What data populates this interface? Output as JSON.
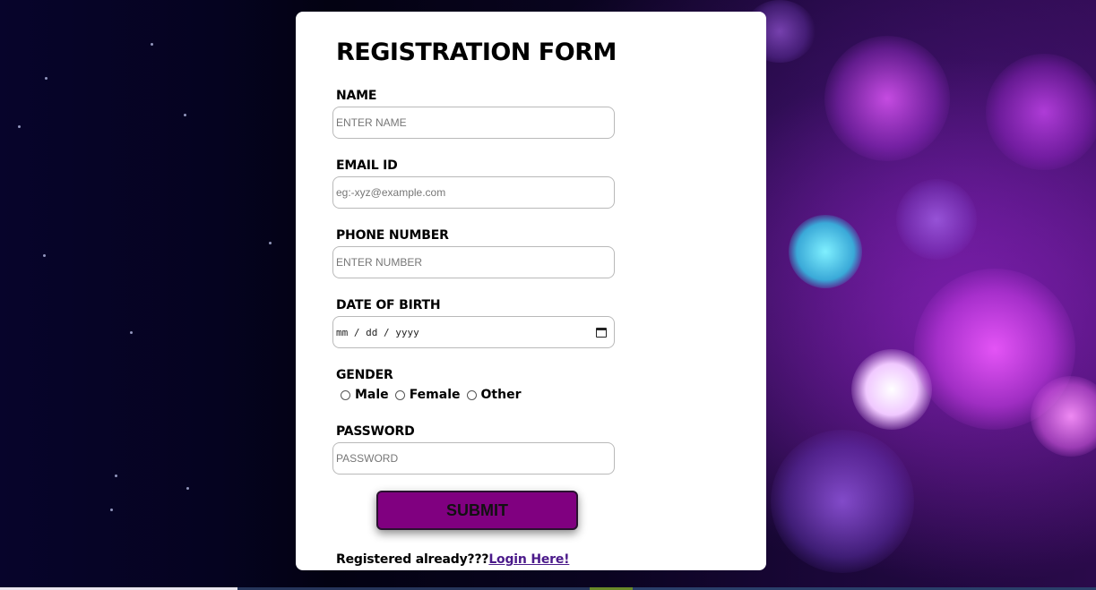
{
  "form": {
    "title": "REGISTRATION FORM",
    "name": {
      "label": "NAME",
      "placeholder": "ENTER NAME"
    },
    "email": {
      "label": "EMAIL ID",
      "placeholder": "eg:-xyz@example.com"
    },
    "phone": {
      "label": "PHONE NUMBER",
      "placeholder": "ENTER NUMBER"
    },
    "dob": {
      "label": "DATE OF BIRTH",
      "placeholder": "mm / dd / yyyy",
      "icon": "calendar-icon"
    },
    "gender": {
      "label": "GENDER",
      "options": [
        "Male",
        "Female",
        "Other"
      ]
    },
    "password": {
      "label": "PASSWORD",
      "placeholder": "PASSWORD"
    },
    "submit_label": "SUBMIT",
    "footer_text": "Registered already???",
    "footer_link": "Login Here!"
  },
  "colors": {
    "submit_bg": "#800080",
    "link": "#4b1a8a",
    "card_bg": "#ffffff"
  }
}
